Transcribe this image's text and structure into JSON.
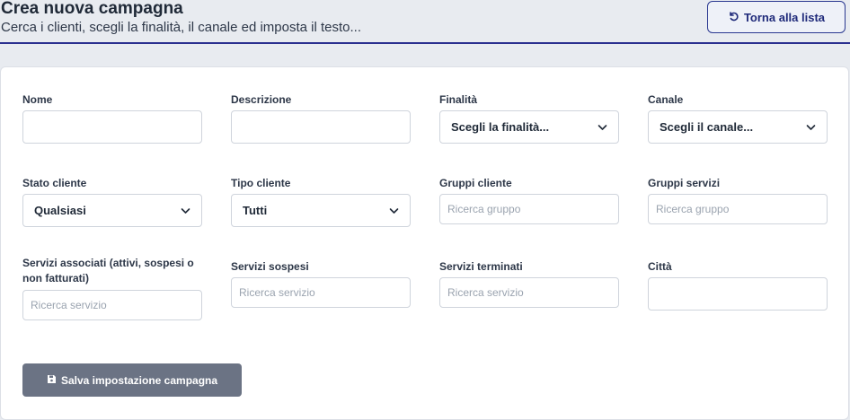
{
  "header": {
    "title": "Crea nuova campagna",
    "subtitle": "Cerca i clienti, scegli la finalità, il canale ed imposta il testo...",
    "back_button": "Torna alla lista"
  },
  "form": {
    "nome": {
      "label": "Nome",
      "value": ""
    },
    "descrizione": {
      "label": "Descrizione",
      "value": ""
    },
    "finalita": {
      "label": "Finalità",
      "selected": "Scegli la finalità..."
    },
    "canale": {
      "label": "Canale",
      "selected": "Scegli il canale..."
    },
    "stato_cliente": {
      "label": "Stato cliente",
      "selected": "Qualsiasi"
    },
    "tipo_cliente": {
      "label": "Tipo cliente",
      "selected": "Tutti"
    },
    "gruppi_cliente": {
      "label": "Gruppi cliente",
      "placeholder": "Ricerca gruppo"
    },
    "gruppi_servizi": {
      "label": "Gruppi servizi",
      "placeholder": "Ricerca gruppo"
    },
    "servizi_associati": {
      "label_line1": "Servizi associati (attivi, sospesi o",
      "label_line2": "non fatturati)",
      "placeholder": "Ricerca servizio"
    },
    "servizi_sospesi": {
      "label": "Servizi sospesi",
      "placeholder": "Ricerca servizio"
    },
    "servizi_terminati": {
      "label": "Servizi terminati",
      "placeholder": "Ricerca servizio"
    },
    "citta": {
      "label": "Città",
      "value": ""
    }
  },
  "save_button": "Salva impostazione campagna",
  "icons": {
    "back": "undo-icon",
    "save": "floppy-disk-icon",
    "dropdown": "chevron-down-icon"
  },
  "colors": {
    "accent": "#2a2f8f",
    "save_button_bg": "#6b7384"
  }
}
